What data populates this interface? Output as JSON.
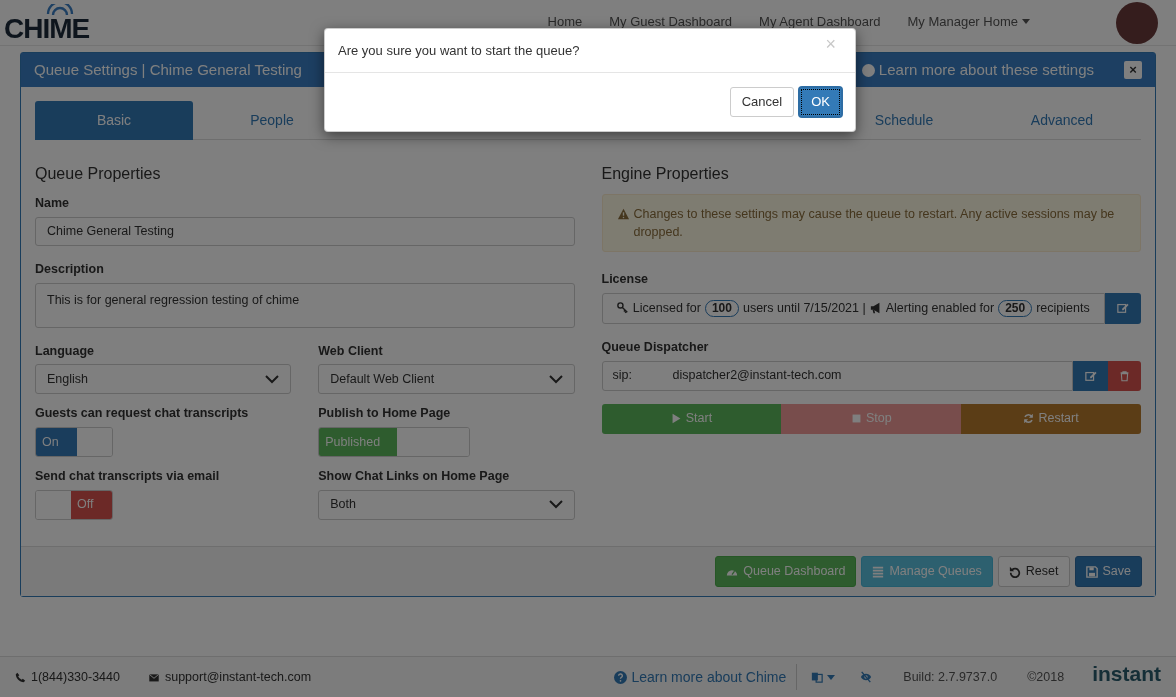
{
  "logo": "CHIME",
  "nav": [
    {
      "label": "Home",
      "dropdown": false
    },
    {
      "label": "My Guest Dashboard",
      "dropdown": false
    },
    {
      "label": "My Agent Dashboard",
      "dropdown": false
    },
    {
      "label": "My Manager Home",
      "dropdown": true
    }
  ],
  "panel": {
    "title": "Queue Settings | Chime General Testing",
    "help_link": "Learn more about these settings"
  },
  "tabs": {
    "left": [
      {
        "label": "Basic",
        "selected": true
      },
      {
        "label": "People",
        "selected": false
      }
    ],
    "right": [
      {
        "label": "Schedule",
        "selected": false
      },
      {
        "label": "Advanced",
        "selected": false
      }
    ]
  },
  "queue_properties": {
    "heading": "Queue Properties",
    "name": {
      "label": "Name",
      "value": "Chime General Testing"
    },
    "description": {
      "label": "Description",
      "value": "This is for general regression testing of chime"
    },
    "fields": [
      {
        "kind": "select",
        "label": "Language",
        "value": "English"
      },
      {
        "kind": "select",
        "label": "Web Client",
        "value": "Default Web Client"
      },
      {
        "kind": "toggle",
        "label": "Guests can request chat transcripts",
        "value": "On",
        "on": true,
        "color": "#1a3d5c"
      },
      {
        "kind": "toggle",
        "label": "Publish to Home Page",
        "value": "Published",
        "on": true,
        "color": "#2e5c2e"
      },
      {
        "kind": "toggle",
        "label": "Send chat transcripts via email",
        "value": "Off",
        "on": false,
        "color": "#6c2927"
      },
      {
        "kind": "select",
        "label": "Show Chat Links on Home Page",
        "value": "Both"
      }
    ]
  },
  "engine_properties": {
    "heading": "Engine Properties",
    "warning": "Changes to these settings may cause the queue to restart. Any active sessions may be dropped.",
    "license": {
      "label": "License",
      "parts": [
        "Licensed for",
        "100",
        "users until 7/15/2021 |",
        "Alerting enabled for",
        "250",
        "recipients"
      ]
    },
    "dispatcher": {
      "label": "Queue Dispatcher",
      "prefix": "sip:",
      "value": "dispatcher2@instant-tech.com"
    },
    "controls": [
      {
        "kind": "start",
        "label": "Start"
      },
      {
        "kind": "stop",
        "label": "Stop"
      },
      {
        "kind": "restart",
        "label": "Restart"
      }
    ]
  },
  "actions": [
    {
      "kind": "dashboard",
      "label": "Queue Dashboard"
    },
    {
      "kind": "manage",
      "label": "Manage Queues"
    },
    {
      "kind": "reset",
      "label": "Reset"
    },
    {
      "kind": "save",
      "label": "Save"
    }
  ],
  "footer": {
    "phone": "1(844)330-3440",
    "email": "support@instant-tech.com",
    "help_link": "Learn more about Chime",
    "build": "Build: 2.7.9737.0",
    "copyright": "©2018",
    "brand": "instant"
  },
  "dialog": {
    "message": "Are you sure you want to start the queue?",
    "close": "×",
    "buttons": [
      {
        "label": "Cancel",
        "primary": false
      },
      {
        "label": "OK",
        "primary": true
      }
    ]
  }
}
